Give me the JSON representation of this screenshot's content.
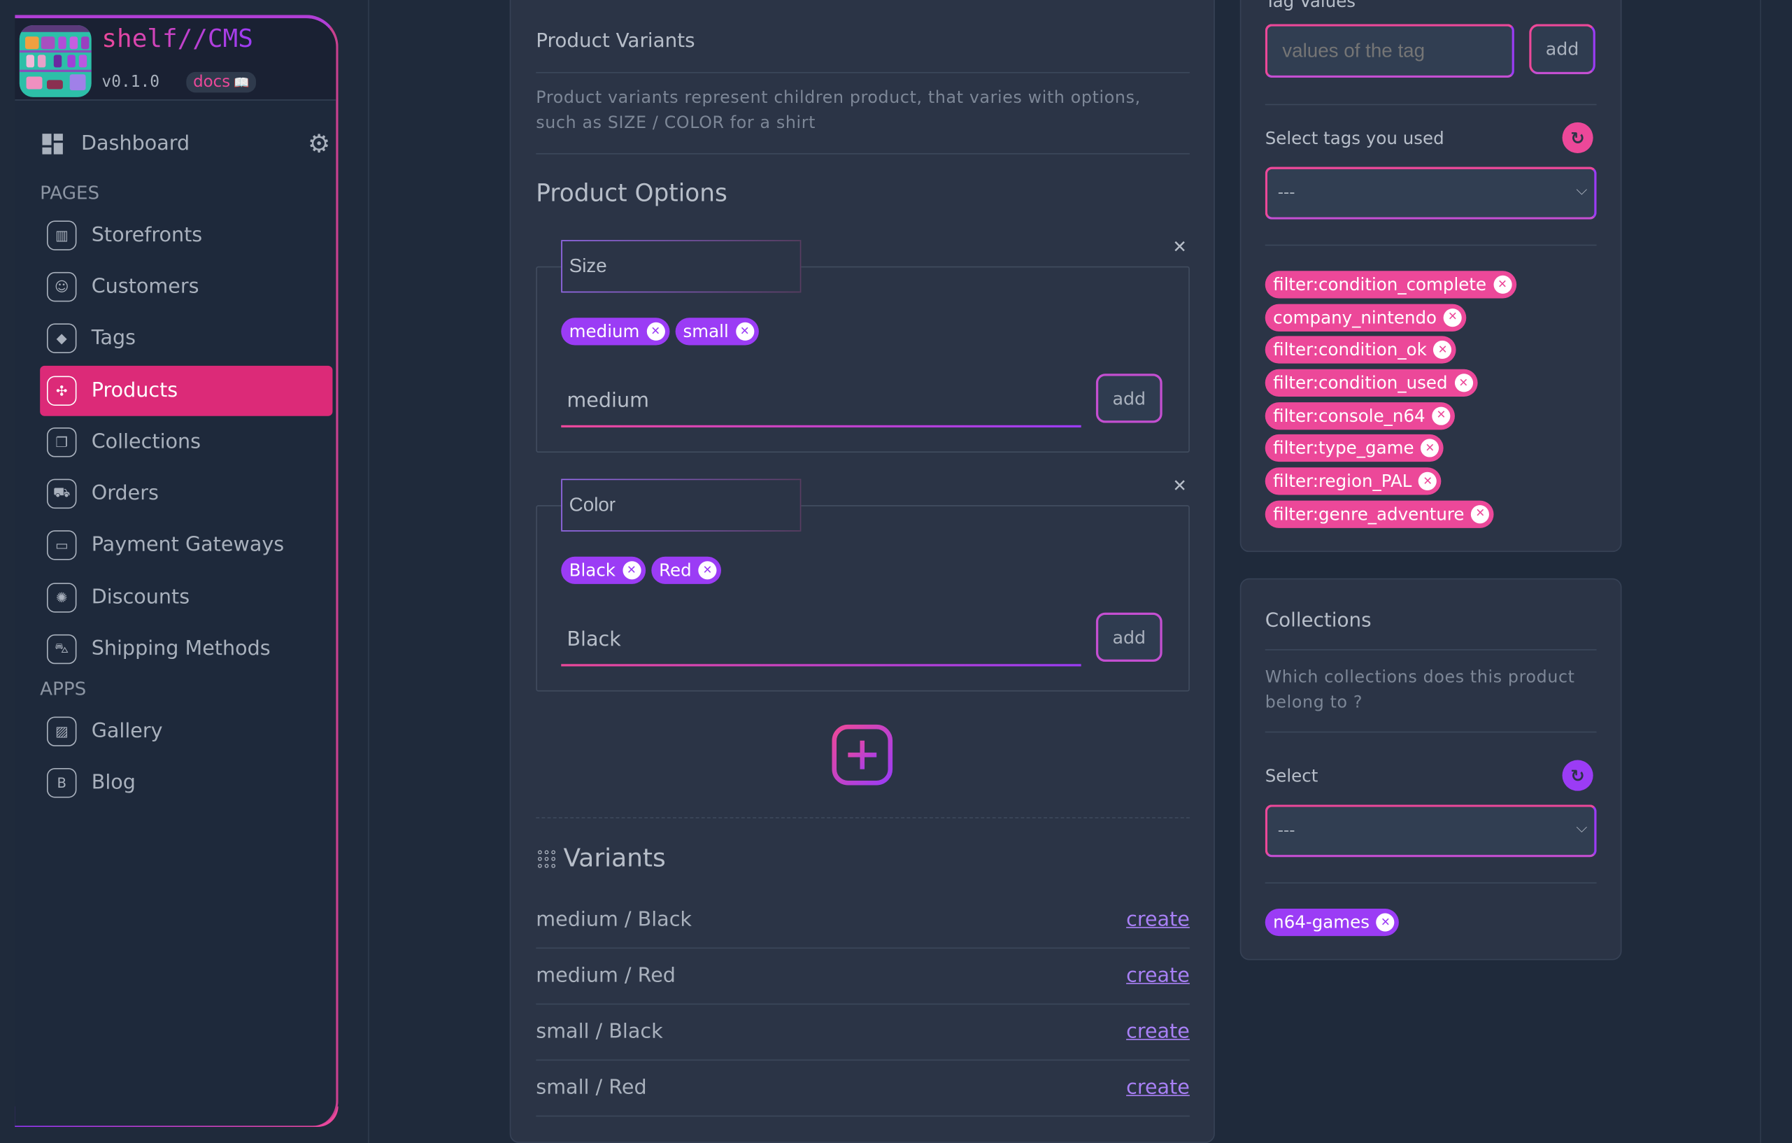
{
  "brand": {
    "name": "shelf//CMS",
    "version": "v0.1.0",
    "docs_label": "docs",
    "docs_icon": "📖"
  },
  "sidebar": {
    "dashboard": "Dashboard",
    "pages_label": "PAGES",
    "pages": [
      {
        "label": "Storefronts",
        "icon": "storefront-icon"
      },
      {
        "label": "Customers",
        "icon": "user-icon"
      },
      {
        "label": "Tags",
        "icon": "tag-icon"
      },
      {
        "label": "Products",
        "icon": "product-icon",
        "active": true
      },
      {
        "label": "Collections",
        "icon": "collections-icon"
      },
      {
        "label": "Orders",
        "icon": "cart-icon"
      },
      {
        "label": "Payment Gateways",
        "icon": "card-icon"
      },
      {
        "label": "Discounts",
        "icon": "discount-icon"
      },
      {
        "label": "Shipping Methods",
        "icon": "truck-icon"
      }
    ],
    "apps_label": "APPS",
    "apps": [
      {
        "label": "Gallery",
        "icon": "gallery-icon"
      },
      {
        "label": "Blog",
        "icon": "blog-icon"
      }
    ]
  },
  "variants_panel": {
    "title": "Product Variants",
    "description_1": "Product variants represent children product, that varies with options,",
    "description_2": "such as SIZE / COLOR for a shirt",
    "options_title": "Product Options",
    "options": [
      {
        "name": "Size",
        "values": [
          "medium",
          "small"
        ],
        "input_value": "medium",
        "add_label": "add"
      },
      {
        "name": "Color",
        "values": [
          "Black",
          "Red"
        ],
        "input_value": "Black",
        "add_label": "add"
      }
    ],
    "variants_title": "Variants",
    "variants": [
      {
        "label": "medium / Black",
        "action": "create"
      },
      {
        "label": "medium / Red",
        "action": "create"
      },
      {
        "label": "small / Black",
        "action": "create"
      },
      {
        "label": "small / Red",
        "action": "create"
      }
    ]
  },
  "tags_panel": {
    "tag_values_label": "Tag Values",
    "tag_values_placeholder": "values of the tag",
    "add_label": "add",
    "select_label": "Select tags you used",
    "select_value": "---",
    "tags": [
      "filter:condition_complete",
      "company_nintendo",
      "filter:condition_ok",
      "filter:condition_used",
      "filter:console_n64",
      "filter:type_game",
      "filter:region_PAL",
      "filter:genre_adventure"
    ]
  },
  "collections_panel": {
    "title": "Collections",
    "description_1": "Which collections does this product",
    "description_2": "belong to ?",
    "select_label": "Select",
    "select_value": "---",
    "collections": [
      "n64-games"
    ]
  },
  "colors": {
    "pink": "#ec4899",
    "purple": "#9b3cf5",
    "background": "#1f2a3b",
    "panel": "#2b3446"
  }
}
